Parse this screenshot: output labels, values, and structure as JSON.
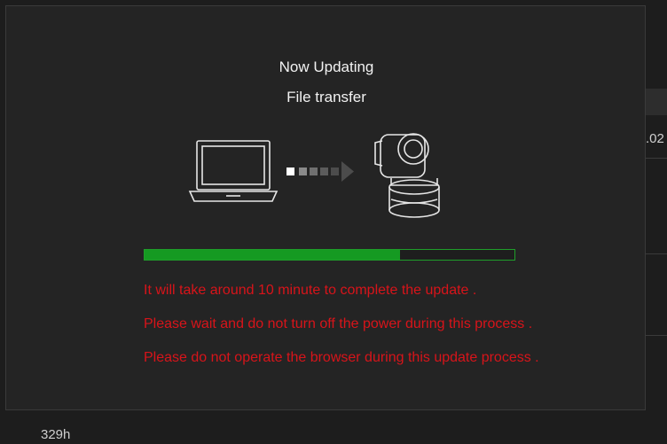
{
  "dialog": {
    "title": "Now Updating",
    "subtitle": "File transfer",
    "progress_percent": 69,
    "messages": [
      "It will take around 10 minute to complete the update .",
      "Please wait and do not turn off the power during this process .",
      "Please do not operate the browser during this update process ."
    ],
    "colors": {
      "progress": "#159a22",
      "warning_text": "#d8141a"
    },
    "icons": [
      "laptop-icon",
      "transfer-arrow-icon",
      "ptz-camera-icon"
    ]
  },
  "background": {
    "right_value": ".02",
    "footer_value": "329h"
  }
}
